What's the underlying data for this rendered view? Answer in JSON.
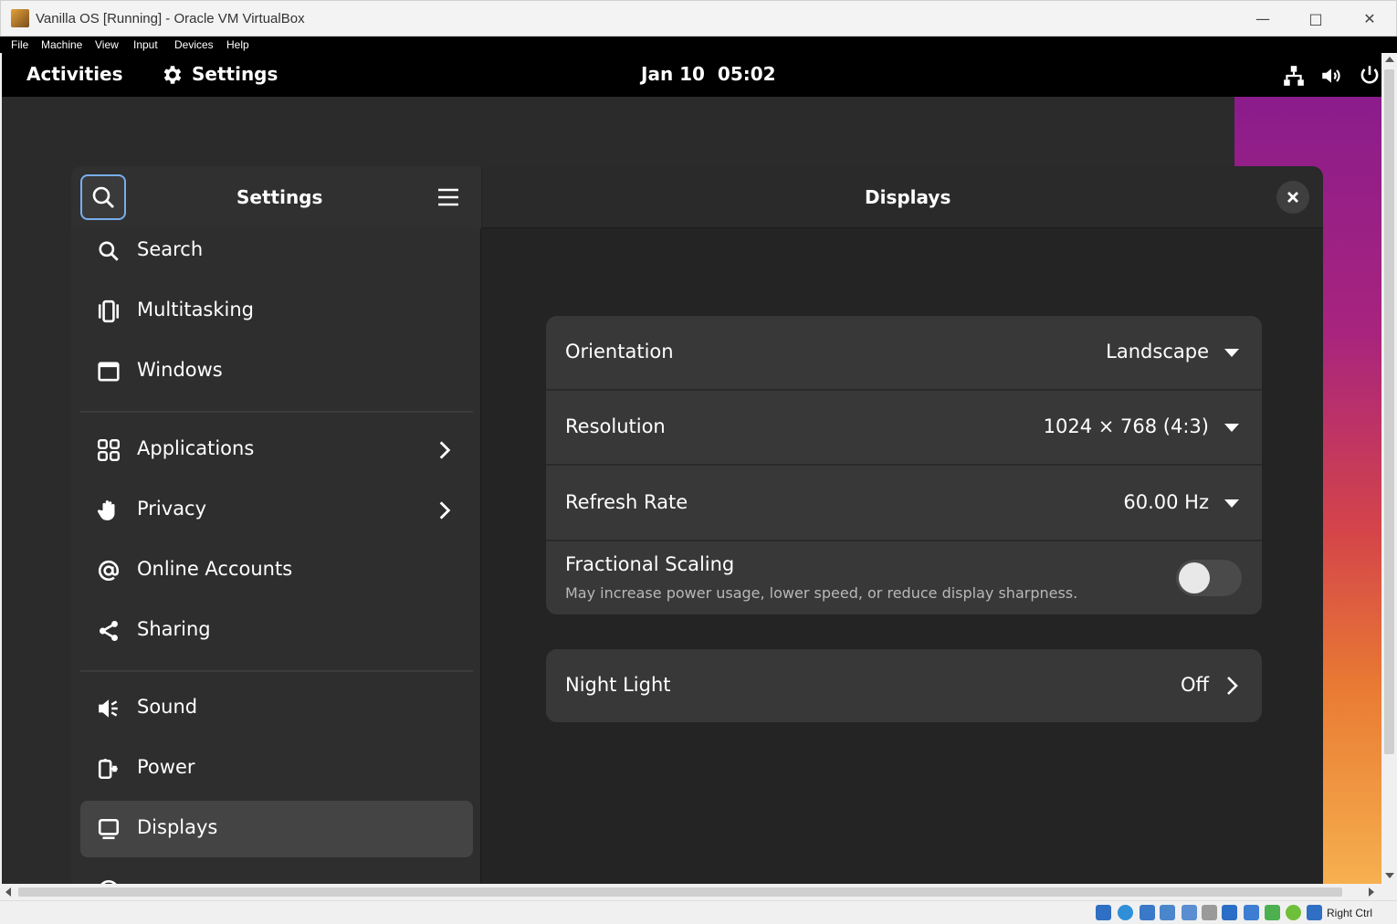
{
  "host": {
    "title": "Vanilla OS [Running] - Oracle VM VirtualBox",
    "menu": [
      "File",
      "Machine",
      "View",
      "Input",
      "Devices",
      "Help"
    ],
    "host_key": "Right Ctrl"
  },
  "topbar": {
    "activities": "Activities",
    "app_name": "Settings",
    "clock": "Jan 10  05:02"
  },
  "settings": {
    "sidebar_title": "Settings",
    "content_title": "Displays",
    "sidebar_items": [
      {
        "label": "Search",
        "icon": "search-icon"
      },
      {
        "label": "Multitasking",
        "icon": "multitasking-icon"
      },
      {
        "label": "Windows",
        "icon": "window-icon"
      },
      {
        "label": "Applications",
        "icon": "apps-grid-icon",
        "has_arrow": true
      },
      {
        "label": "Privacy",
        "icon": "hand-icon",
        "has_arrow": true
      },
      {
        "label": "Online Accounts",
        "icon": "at-icon"
      },
      {
        "label": "Sharing",
        "icon": "share-icon"
      },
      {
        "label": "Sound",
        "icon": "speaker-icon"
      },
      {
        "label": "Power",
        "icon": "power-plug-icon"
      },
      {
        "label": "Displays",
        "icon": "display-icon",
        "active": true
      }
    ],
    "display": {
      "orientation": {
        "label": "Orientation",
        "value": "Landscape"
      },
      "resolution": {
        "label": "Resolution",
        "value": "1024 × 768 (4:3)"
      },
      "refresh_rate": {
        "label": "Refresh Rate",
        "value": "60.00 Hz"
      },
      "fractional_scaling": {
        "label": "Fractional Scaling",
        "subtitle": "May increase power usage, lower speed, or reduce display sharpness.",
        "enabled": false
      },
      "night_light": {
        "label": "Night Light",
        "value": "Off"
      }
    }
  },
  "colors": {
    "accent": "#78aeed",
    "window_bg": "#242424",
    "sidebar_bg": "#2e2e2e",
    "card_bg": "#383838"
  }
}
